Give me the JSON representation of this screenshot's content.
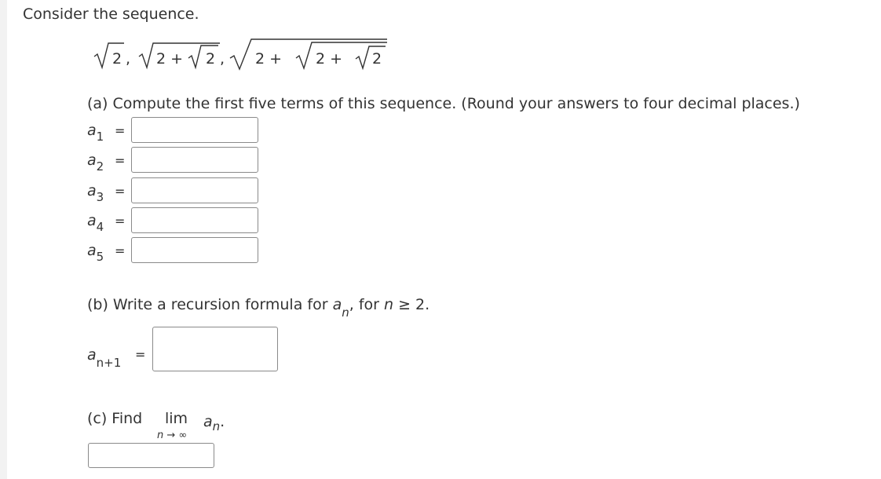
{
  "prompt": "Consider the sequence.",
  "sequence": {
    "term1": {
      "inner": "2"
    },
    "term2": {
      "prefix": "2 +",
      "inner": "2"
    },
    "term3": {
      "prefix1": "2 +",
      "prefix2": "2 +",
      "inner": "2"
    },
    "separator": ","
  },
  "part_a": {
    "text": "(a) Compute the first five terms of this sequence. (Round your answers to four decimal places.)",
    "rows": [
      {
        "var": "a",
        "sub": "1",
        "eq": "=",
        "value": ""
      },
      {
        "var": "a",
        "sub": "2",
        "eq": "=",
        "value": ""
      },
      {
        "var": "a",
        "sub": "3",
        "eq": "=",
        "value": ""
      },
      {
        "var": "a",
        "sub": "4",
        "eq": "=",
        "value": ""
      },
      {
        "var": "a",
        "sub": "5",
        "eq": "=",
        "value": ""
      }
    ]
  },
  "part_b": {
    "text_pre": "(b) Write a recursion formula for",
    "var": "a",
    "sub": "n",
    "comma": ",",
    "text_for": "for",
    "n": "n",
    "cond": "≥ 2.",
    "answer": {
      "var": "a",
      "sub": "n+1",
      "eq": "=",
      "value": ""
    }
  },
  "part_c": {
    "text": "(c) Find",
    "lim": "lim",
    "lim_sub": "n → ∞",
    "var": "a",
    "sub": "n",
    "period": ".",
    "value": ""
  }
}
